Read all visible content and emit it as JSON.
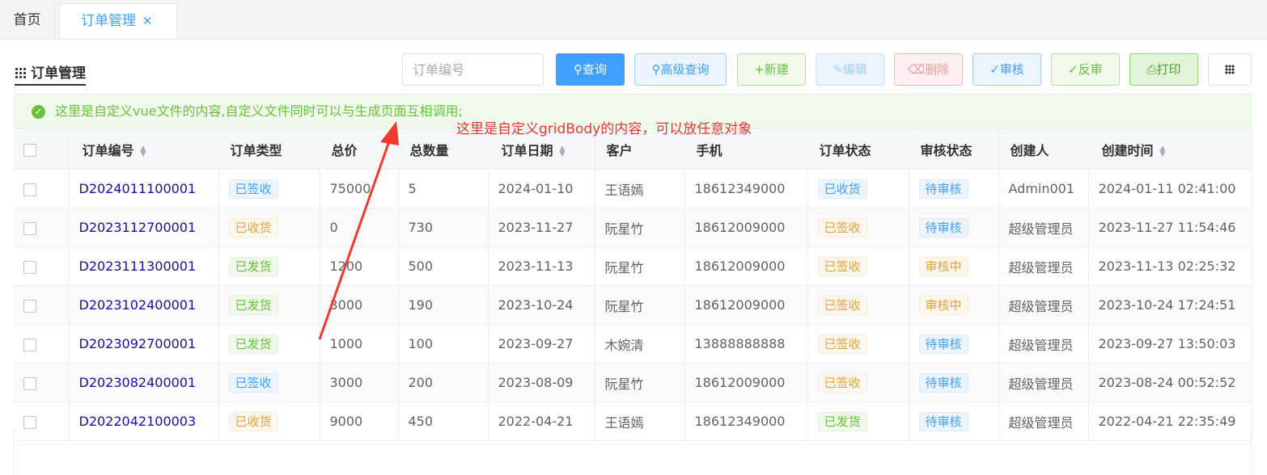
{
  "tabs": {
    "home": "首页",
    "active": "订单管理",
    "close": "✕"
  },
  "page_title": "订单管理",
  "search": {
    "placeholder": "订单编号",
    "value": ""
  },
  "toolbar": {
    "query": "查询",
    "advanced": "高级查询",
    "new": "新建",
    "edit": "编辑",
    "delete": "删除",
    "audit": "审核",
    "unaudit": "反审",
    "print": "打印"
  },
  "alert": {
    "text": "这里是自定义vue文件的内容,自定义文件同时可以与生成页面互相调用;"
  },
  "annotation": "这里是自定义gridBody的内容，可以放任意对象",
  "columns": [
    "订单编号",
    "订单类型",
    "总价",
    "总数量",
    "订单日期",
    "客户",
    "手机",
    "订单状态",
    "审核状态",
    "创建人",
    "创建时间"
  ],
  "rows": [
    {
      "no": "D2024011100001",
      "type": "已签收",
      "type_color": "blue",
      "total": "75000",
      "qty": "5",
      "date": "2024-01-10",
      "customer": "王语嫣",
      "phone": "18612349000",
      "status": "已收货",
      "status_color": "blue",
      "audit": "待审核",
      "audit_color": "blue",
      "creator": "Admin001",
      "created": "2024-01-11 02:41:00"
    },
    {
      "no": "D2023112700001",
      "type": "已收货",
      "type_color": "orange",
      "total": "0",
      "qty": "730",
      "date": "2023-11-27",
      "customer": "阮星竹",
      "phone": "18612009000",
      "status": "已签收",
      "status_color": "orange",
      "audit": "待审核",
      "audit_color": "blue",
      "creator": "超级管理员",
      "created": "2023-11-27 11:54:46"
    },
    {
      "no": "D2023111300001",
      "type": "已发货",
      "type_color": "green",
      "total": "1200",
      "qty": "500",
      "date": "2023-11-13",
      "customer": "阮星竹",
      "phone": "18612009000",
      "status": "已签收",
      "status_color": "orange",
      "audit": "审核中",
      "audit_color": "orange",
      "creator": "超级管理员",
      "created": "2023-11-13 02:25:32"
    },
    {
      "no": "D2023102400001",
      "type": "已发货",
      "type_color": "green",
      "total": "3000",
      "qty": "190",
      "date": "2023-10-24",
      "customer": "阮星竹",
      "phone": "18612009000",
      "status": "已签收",
      "status_color": "orange",
      "audit": "审核中",
      "audit_color": "orange",
      "creator": "超级管理员",
      "created": "2023-10-24 17:24:51"
    },
    {
      "no": "D2023092700001",
      "type": "已发货",
      "type_color": "green",
      "total": "1000",
      "qty": "100",
      "date": "2023-09-27",
      "customer": "木婉清",
      "phone": "13888888888",
      "status": "已签收",
      "status_color": "orange",
      "audit": "待审核",
      "audit_color": "blue",
      "creator": "超级管理员",
      "created": "2023-09-27 13:50:03"
    },
    {
      "no": "D2023082400001",
      "type": "已签收",
      "type_color": "blue",
      "total": "3000",
      "qty": "200",
      "date": "2023-08-09",
      "customer": "阮星竹",
      "phone": "18612009000",
      "status": "已签收",
      "status_color": "orange",
      "audit": "待审核",
      "audit_color": "blue",
      "creator": "超级管理员",
      "created": "2023-08-24 00:52:52"
    },
    {
      "no": "D2022042100003",
      "type": "已收货",
      "type_color": "orange",
      "total": "9000",
      "qty": "450",
      "date": "2022-04-21",
      "customer": "王语嫣",
      "phone": "18612349000",
      "status": "已发货",
      "status_color": "green",
      "audit": "待审核",
      "audit_color": "blue",
      "creator": "超级管理员",
      "created": "2022-04-21 22:35:49"
    }
  ],
  "colors": {
    "primary": "#409eff",
    "success": "#67c23a",
    "warning": "#e6a23c",
    "danger": "#f56c6c",
    "annotation": "#e53935"
  }
}
